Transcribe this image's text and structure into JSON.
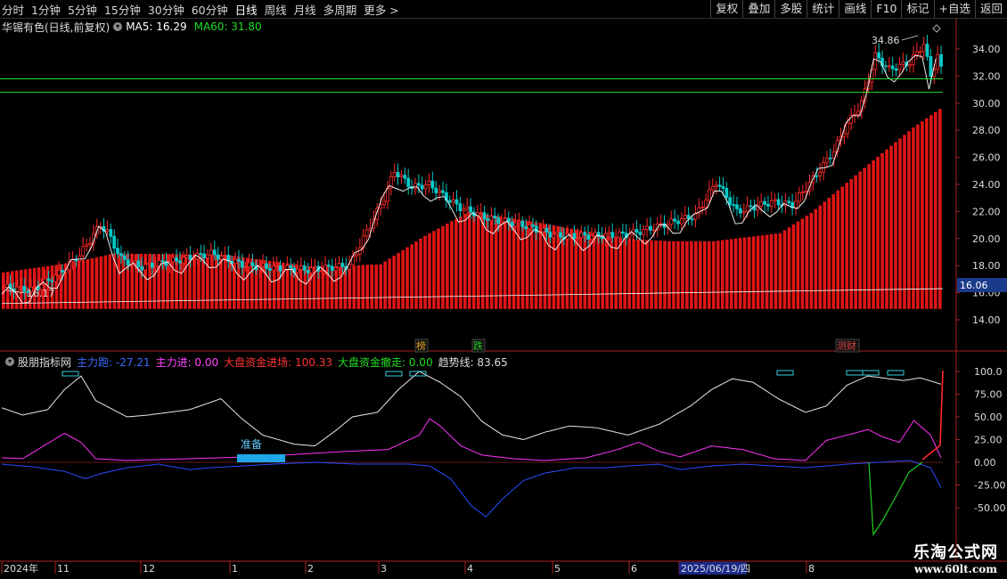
{
  "toolbar": {
    "periods": [
      "分时",
      "1分钟",
      "5分钟",
      "15分钟",
      "30分钟",
      "60分钟",
      "日线",
      "周线",
      "月线",
      "多周期",
      "更多 >"
    ],
    "active": "日线",
    "actions": [
      "复权",
      "叠加",
      "多股",
      "统计",
      "画线",
      "F10",
      "标记",
      "+自选",
      "返回"
    ]
  },
  "main_chart": {
    "stock_title": "华锡有色(日线,前复权)",
    "ma5_label": "MA5: 16.29",
    "ma60_label": "MA60: 31.80",
    "high_label": "34.86",
    "low_label": "16.17",
    "price_tag": "16.06",
    "y_ticks": [
      "34.00",
      "32.00",
      "30.00",
      "28.00",
      "26.00",
      "24.00",
      "22.00",
      "20.00",
      "18.00",
      "16.00",
      "14.00"
    ],
    "tags": [
      {
        "text": "榜",
        "color": "#e0a020"
      },
      {
        "text": "跌",
        "color": "#22cc22"
      },
      {
        "text": "测财",
        "color": "#dd4444"
      }
    ]
  },
  "indicator": {
    "name": "股朋指标网",
    "params": [
      {
        "text": "主力跑: -27.21",
        "color": "#3b6bff"
      },
      {
        "text": "主力进: 0.00",
        "color": "#ff44ff"
      },
      {
        "text": "大盘资金进场: 100.33",
        "color": "#ff3333"
      },
      {
        "text": "大盘资金撤走: 0.00",
        "color": "#22dd22"
      },
      {
        "text": "趋势线: 83.65",
        "color": "#dddddd"
      }
    ],
    "prepare_label": "准备",
    "y_ticks": [
      "100.0",
      "75.00",
      "50.00",
      "25.00",
      "0.00",
      "-25.00",
      "-50.00"
    ]
  },
  "date_axis": [
    "2024年",
    "11",
    "12",
    "1",
    "2",
    "3",
    "4",
    "5",
    "6",
    "2025/06/19/四",
    "8"
  ],
  "watermark": {
    "line1": "乐淘公式网",
    "line2": "www.60lt.com"
  },
  "colors": {
    "up": "#ff2a2a",
    "down": "#00c8c8",
    "ma_line": "#ffffff",
    "trend": "#e8e8e8",
    "main_out": "#2a4bff",
    "main_in": "#ff33ff",
    "big_in": "#ff2a2a",
    "big_out": "#22cc22"
  }
}
